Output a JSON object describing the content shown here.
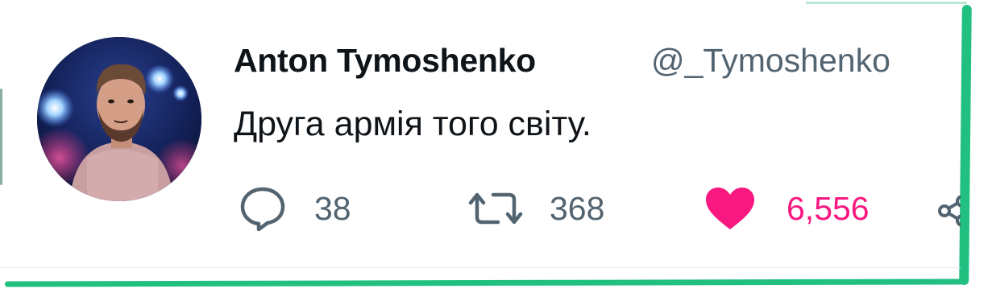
{
  "tweet": {
    "author_name": "Anton Tymoshenko",
    "author_handle": "@_Tymoshenko",
    "text": "Друга армія того світу.",
    "avatar_alt": "profile photo"
  },
  "actions": {
    "reply_count": "38",
    "retweet_count": "368",
    "like_count": "6,556",
    "reply_icon": "comment-bubble-icon",
    "retweet_icon": "retweet-arrows-icon",
    "like_icon": "heart-icon",
    "share_icon": "share-icon"
  },
  "colors": {
    "text_primary": "#0f1419",
    "text_secondary": "#536471",
    "like_active": "#f91880",
    "frame_accent": "#22c080"
  }
}
